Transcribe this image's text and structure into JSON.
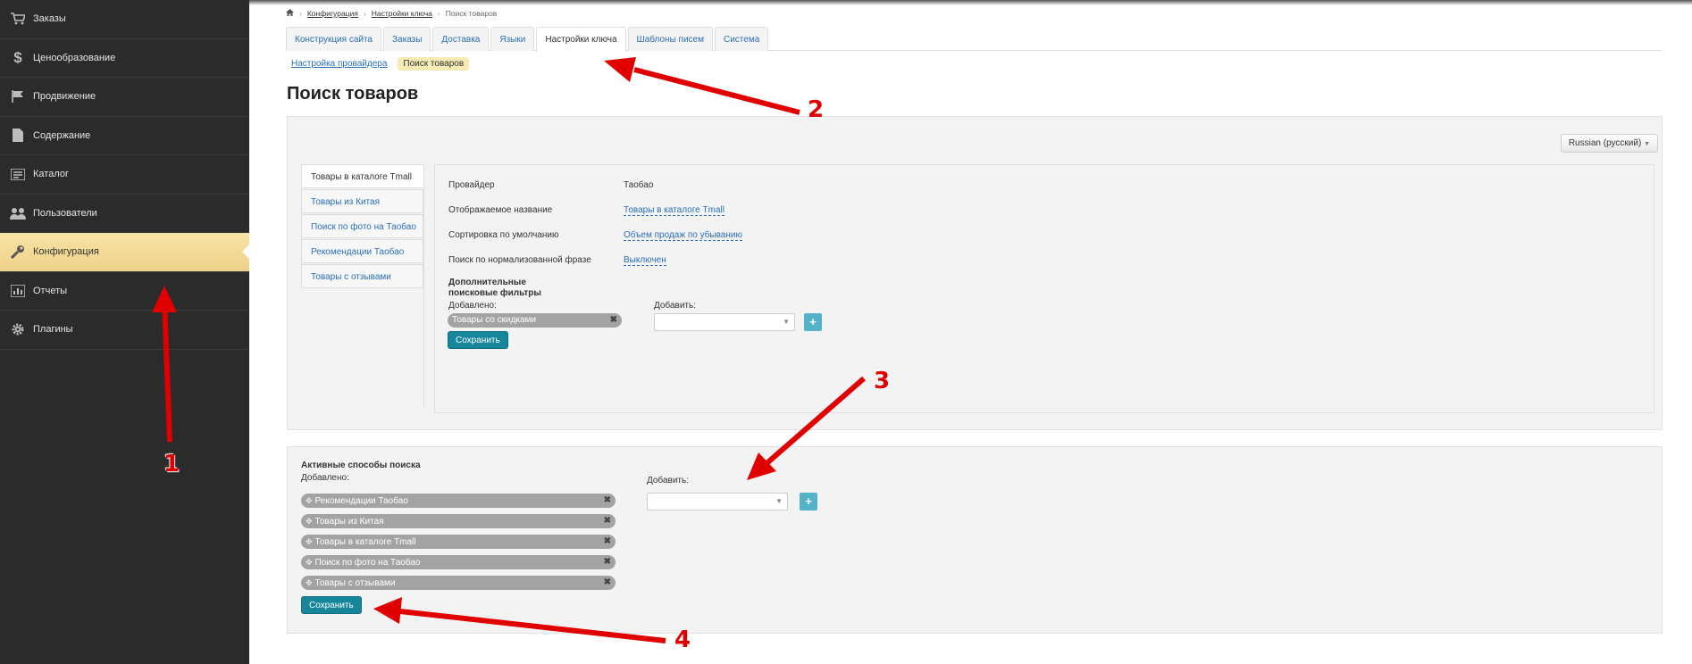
{
  "sidebar": {
    "items": [
      {
        "label": "Заказы",
        "icon": "cart-icon",
        "active": false
      },
      {
        "label": "Ценообразование",
        "icon": "dollar-icon",
        "active": false
      },
      {
        "label": "Продвижение",
        "icon": "flag-icon",
        "active": false
      },
      {
        "label": "Содержание",
        "icon": "file-icon",
        "active": false
      },
      {
        "label": "Каталог",
        "icon": "catalog-icon",
        "active": false
      },
      {
        "label": "Пользователи",
        "icon": "users-icon",
        "active": false
      },
      {
        "label": "Конфигурация",
        "icon": "wrench-icon",
        "active": true
      },
      {
        "label": "Отчеты",
        "icon": "chart-icon",
        "active": false
      },
      {
        "label": "Плагины",
        "icon": "gear-icon",
        "active": false
      }
    ]
  },
  "breadcrumb": {
    "items": [
      "Конфигурация",
      "Настройки ключа",
      "Поиск товаров"
    ]
  },
  "tabs": {
    "items": [
      {
        "label": "Конструкция сайта",
        "active": false
      },
      {
        "label": "Заказы",
        "active": false
      },
      {
        "label": "Доставка",
        "active": false
      },
      {
        "label": "Языки",
        "active": false
      },
      {
        "label": "Настройки ключа",
        "active": true
      },
      {
        "label": "Шаблоны писем",
        "active": false
      },
      {
        "label": "Система",
        "active": false
      }
    ]
  },
  "subnav": {
    "link": "Настройка провайдера",
    "current": "Поиск товаров"
  },
  "page_title": "Поиск товаров",
  "language_button": "Russian (русский)",
  "vtabs": {
    "items": [
      {
        "label": "Товары в каталоге Tmall",
        "active": true
      },
      {
        "label": "Товары из Китая",
        "active": false
      },
      {
        "label": "Поиск по фото на Таобао",
        "active": false
      },
      {
        "label": "Рекомендации Таобао",
        "active": false
      },
      {
        "label": "Товары с отзывами",
        "active": false
      }
    ]
  },
  "settings": {
    "provider_label": "Провайдер",
    "provider_value": "Таобао",
    "display_name_label": "Отображаемое название",
    "display_name_value": "Товары в каталоге Tmall",
    "sort_label": "Сортировка по умолчанию",
    "sort_value": "Объем продаж по убыванию",
    "normalized_label": "Поиск по нормализованной фразе",
    "normalized_value": "Выключен",
    "filters_title": "Дополнительные поисковые фильтры",
    "added_label": "Добавлено:",
    "add_label": "Добавить:",
    "tags": [
      "Товары со скидками"
    ],
    "save": "Сохранить"
  },
  "active_methods": {
    "title": "Активные способы поиска",
    "added_label": "Добавлено:",
    "add_label": "Добавить:",
    "tags": [
      "Рекомендации Таобао",
      "Товары из Китая",
      "Товары в каталоге Tmall",
      "Поиск по фото на Таобао",
      "Товары с отзывами"
    ],
    "save": "Сохранить"
  },
  "annotations": [
    "1",
    "2",
    "3",
    "4"
  ],
  "colors": {
    "sidebar": "#2b2b2b",
    "active": "#eed188",
    "link": "#2a6fb7",
    "primary": "#17869a",
    "arrow": "#e00000"
  }
}
